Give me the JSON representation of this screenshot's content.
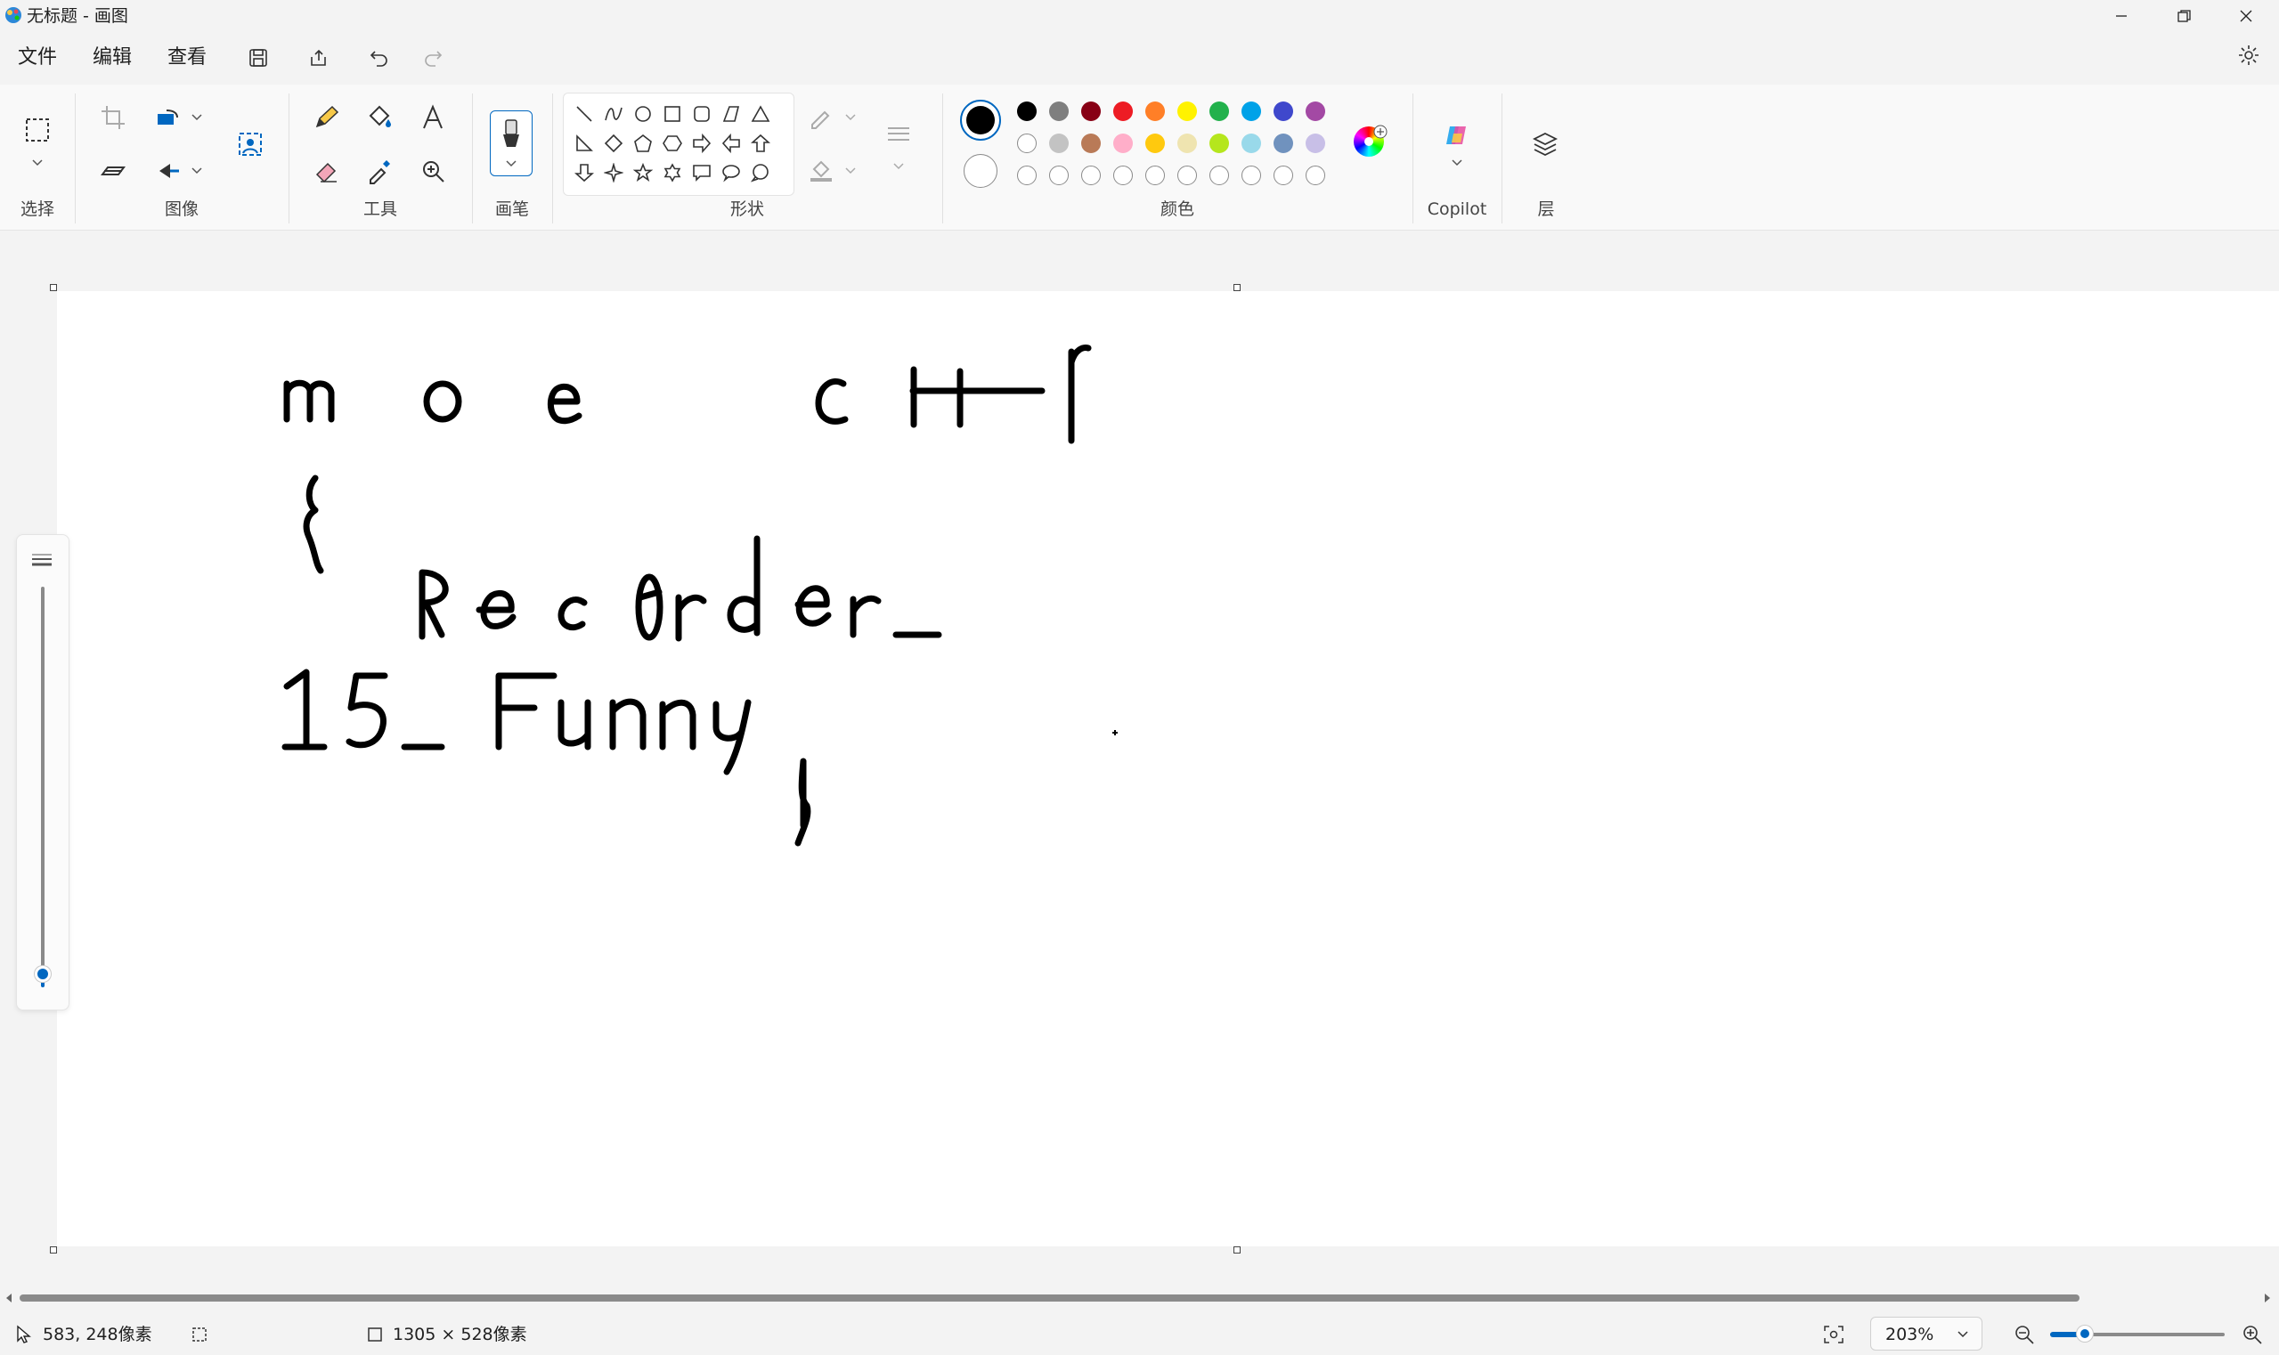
{
  "window": {
    "title": "无标题 - 画图"
  },
  "menu": {
    "file": "文件",
    "edit": "编辑",
    "view": "查看"
  },
  "ribbon": {
    "groups": {
      "select": "选择",
      "image": "图像",
      "tools": "工具",
      "brush": "画笔",
      "shapes": "形状",
      "colors": "颜色",
      "copilot": "Copilot",
      "layers": "层"
    },
    "colors": {
      "primary": "#000000",
      "secondary": "#ffffff",
      "row1": [
        "#000000",
        "#7f7f7f",
        "#880015",
        "#ed1c24",
        "#ff7f27",
        "#fff200",
        "#22b14c",
        "#00a2e8",
        "#3f48cc",
        "#a349a4"
      ],
      "row2": [
        "#ffffff",
        "#c3c3c3",
        "#b97a57",
        "#ffaec9",
        "#ffc90e",
        "#efe4b0",
        "#b5e61d",
        "#99d9ea",
        "#7092be",
        "#c8bfe7"
      ]
    }
  },
  "status": {
    "cursor_position": "583, 248像素",
    "canvas_size": "1305 × 528像素",
    "zoom": "203%"
  },
  "zoom_slider": {
    "value_fraction": 0.2
  }
}
